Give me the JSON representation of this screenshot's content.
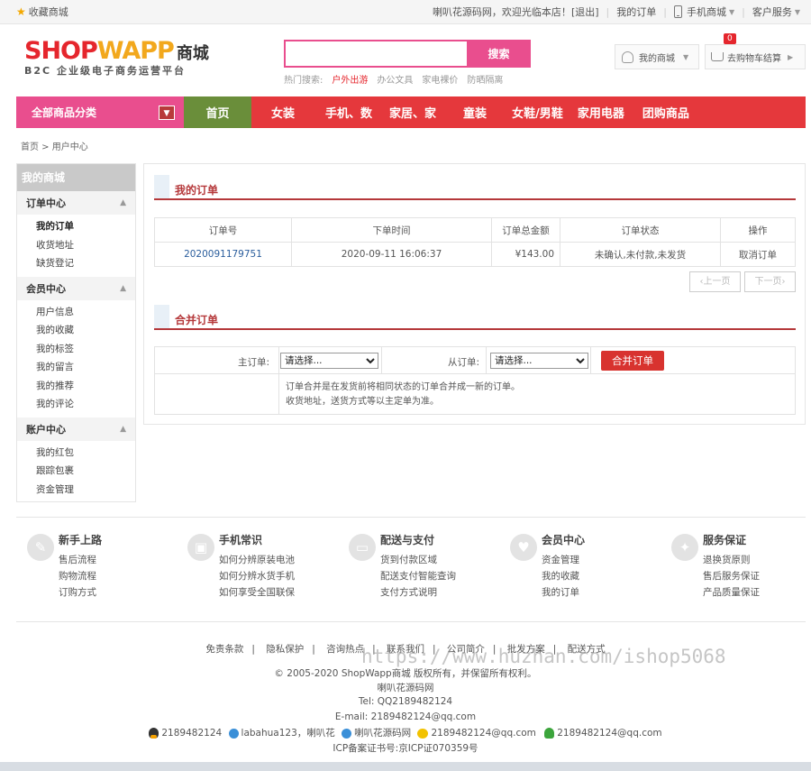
{
  "topbar": {
    "favorite": "收藏商城",
    "welcome": "喇叭花源码网，欢迎光临本店！",
    "logout": "[退出]",
    "my_orders": "我的订单",
    "mobile_mall": "手机商城",
    "customer_service": "客户服务"
  },
  "logo": {
    "shop": "SHOP",
    "wapp": "WAPP",
    "mall": "商城",
    "slogan": "B2C 企业级电子商务运营平台"
  },
  "search": {
    "button": "搜索",
    "hot_label": "热门搜索:",
    "hot_terms": [
      "户外出游",
      "办公文具",
      "家电裸价",
      "防晒隔离"
    ]
  },
  "header": {
    "my_mall": "我的商城",
    "cart": "去购物车结算",
    "cart_count": "0"
  },
  "nav": {
    "all_categories": "全部商品分类",
    "items": [
      "首页",
      "女装",
      "手机、数",
      "家居、家",
      "童装",
      "女鞋/男鞋",
      "家用电器",
      "团购商品"
    ]
  },
  "breadcrumb": "首页 > 用户中心",
  "sidebar": {
    "title": "我的商城",
    "sections": [
      {
        "title": "订单中心",
        "items": [
          "我的订单",
          "收货地址",
          "缺货登记"
        ]
      },
      {
        "title": "会员中心",
        "items": [
          "用户信息",
          "我的收藏",
          "我的标签",
          "我的留言",
          "我的推荐",
          "我的评论"
        ]
      },
      {
        "title": "账户中心",
        "items": [
          "我的红包",
          "跟踪包裹",
          "资金管理"
        ]
      }
    ]
  },
  "orders": {
    "title": "我的订单",
    "columns": [
      "订单号",
      "下单时间",
      "订单总金额",
      "订单状态",
      "操作"
    ],
    "rows": [
      {
        "number": "2020091179751",
        "time": "2020-09-11 16:06:37",
        "total": "¥143.00",
        "status": "未确认,未付款,未发货",
        "action": "取消订单"
      }
    ],
    "prev": "上一页",
    "next": "下一页"
  },
  "merge": {
    "title": "合并订单",
    "main_label": "主订单:",
    "sub_label": "从订单:",
    "select_placeholder": "请选择...",
    "button": "合并订单",
    "note_line1": "订单合并是在发货前将相同状态的订单合并成一新的订单。",
    "note_line2": "收货地址，送货方式等以主定单为准。"
  },
  "help": [
    {
      "icon": "pencil-icon",
      "title": "新手上路",
      "links": [
        "售后流程",
        "购物流程",
        "订购方式"
      ]
    },
    {
      "icon": "bus-icon",
      "title": "手机常识",
      "links": [
        "如何分辨原装电池",
        "如何分辨水货手机",
        "如何享受全国联保"
      ]
    },
    {
      "icon": "wallet-icon",
      "title": "配送与支付",
      "links": [
        "货到付款区域",
        "配送支付智能查询",
        "支付方式说明"
      ]
    },
    {
      "icon": "heart-icon",
      "title": "会员中心",
      "links": [
        "资金管理",
        "我的收藏",
        "我的订单"
      ]
    },
    {
      "icon": "wrench-icon",
      "title": "服务保证",
      "links": [
        "退换货原则",
        "售后服务保证",
        "产品质量保证"
      ]
    }
  ],
  "footer": {
    "links": [
      "免责条款",
      "隐私保护",
      "咨询热点",
      "联系我们",
      "公司简介",
      "批发方案",
      "配送方式"
    ],
    "copyright": "© 2005-2020 ShopWapp商城 版权所有，并保留所有权利。",
    "site": "喇叭花源码网",
    "tel": "Tel: QQ2189482124",
    "email": "E-mail: 2189482124@qq.com",
    "qq": "2189482124",
    "wangwang": "labahua123，喇叭花",
    "yahoo": "喇叭花源码网",
    "msn": "2189482124@qq.com",
    "skype": "2189482124@qq.com",
    "icp": "ICP备案证书号:京ICP证070359号"
  },
  "watermark": "https://www.huzhan.com/ishop5068"
}
